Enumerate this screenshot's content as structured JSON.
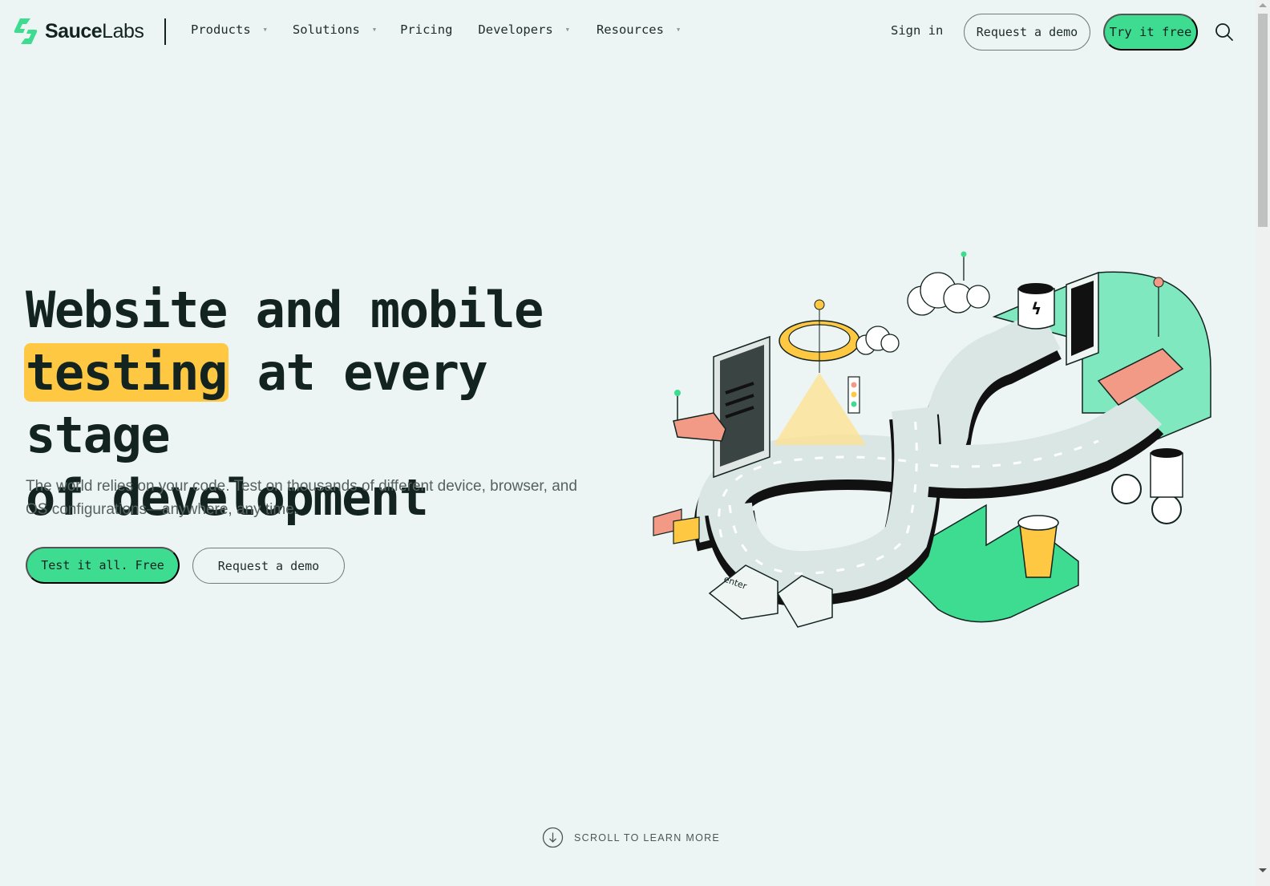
{
  "brand": {
    "name_bold": "Sauce",
    "name_light": "Labs",
    "accent_color": "#3ddc91",
    "highlight_color": "#ffc843",
    "logo_icon": "saucelabs-bolt-icon"
  },
  "nav": {
    "items": [
      {
        "label": "Products",
        "has_dropdown": true
      },
      {
        "label": "Solutions",
        "has_dropdown": true
      },
      {
        "label": "Pricing",
        "has_dropdown": false
      },
      {
        "label": "Developers",
        "has_dropdown": true
      },
      {
        "label": "Resources",
        "has_dropdown": true
      }
    ],
    "caret": "▼",
    "sign_in": "Sign in",
    "request_demo": "Request a demo",
    "try_free": "Try it free",
    "search_icon": "search-icon"
  },
  "hero": {
    "headline_line1": "Website and mobile",
    "headline_highlight": "testing",
    "headline_line2_rest": " at every stage",
    "headline_line3": "of development",
    "subtext": "The world relies on your code. Test on thousands of different device, browser, and OS configurations—anywhere, any time.",
    "cta_primary": "Test it all. Free",
    "cta_secondary": "Request a demo",
    "illustration": "devops-infinity-road-illustration"
  },
  "scroll_hint": {
    "label": "SCROLL TO LEARN MORE",
    "icon": "arrow-down-circle-icon"
  }
}
